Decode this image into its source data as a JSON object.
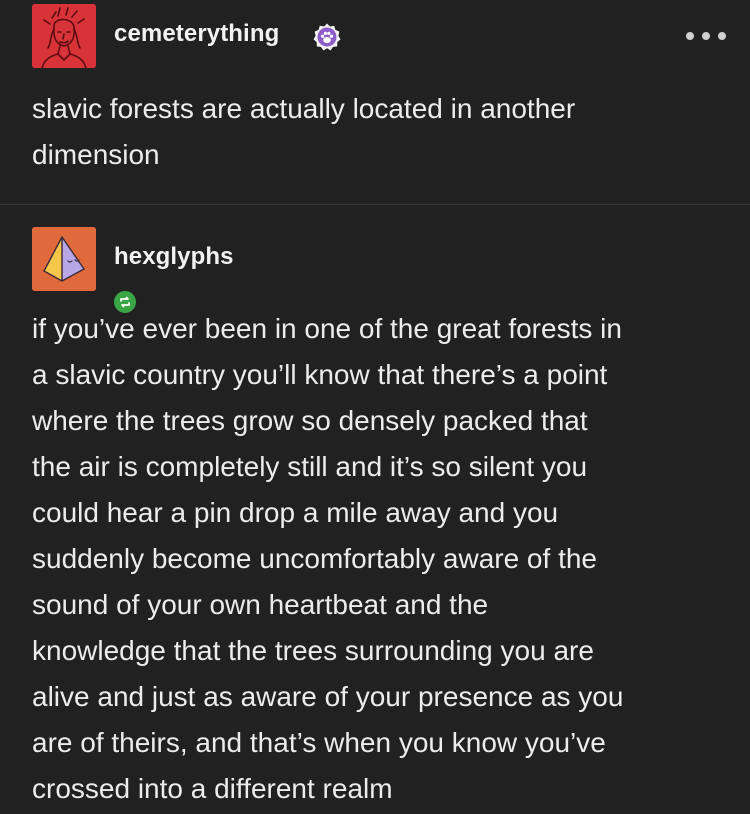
{
  "posts": [
    {
      "username": "cemeterything",
      "text": "slavic forests are actually located in another\ndimension",
      "colors": {
        "avatar_bg": "#d9333a",
        "badge": "#8e5cc9"
      },
      "icons": [
        "avatar-portrait-icon",
        "paw-badge-icon",
        "more-options-icon"
      ]
    },
    {
      "username": "hexglyphs",
      "text": "if you’ve ever been in one of the great forests in\na slavic country  you’ll know that there’s a point\nwhere the trees grow so densely packed  that\nthe air is completely still and it’s so silent you\ncould hear a pin  drop a mile away and you\nsuddenly become uncomfortably aware of the\nsound of your own heartbeat and the\nknowledge that the trees surrounding  you are\nalive and just as aware of your presence as you\nare of theirs,  and that’s when you know you’ve\ncrossed into a different realm",
      "colors": {
        "avatar_bg": "#e06a3c",
        "reblog_badge": "#3aa545"
      },
      "icons": [
        "avatar-pyramid-icon",
        "reblog-icon"
      ]
    }
  ]
}
